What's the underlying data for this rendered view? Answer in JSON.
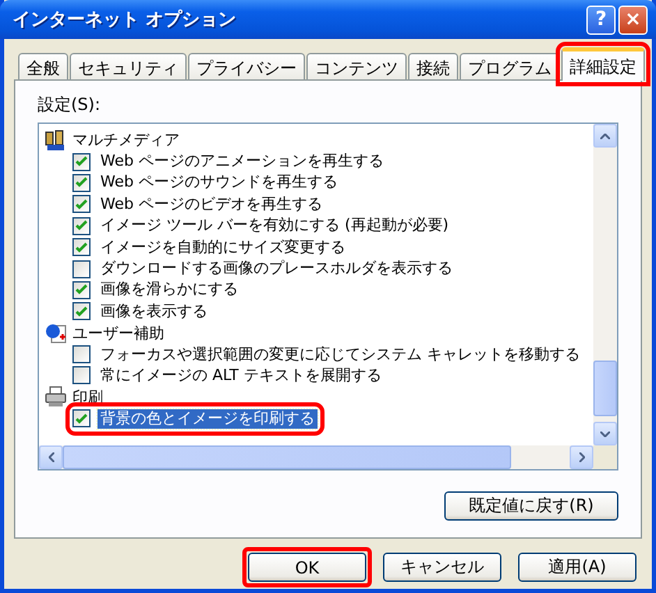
{
  "window": {
    "title": "インターネット オプション",
    "controls": [
      "?",
      "×"
    ]
  },
  "tabs": [
    {
      "label": "全般",
      "selected": false,
      "highlighted": false
    },
    {
      "label": "セキュリティ",
      "selected": false,
      "highlighted": false
    },
    {
      "label": "プライバシー",
      "selected": false,
      "highlighted": false
    },
    {
      "label": "コンテンツ",
      "selected": false,
      "highlighted": false
    },
    {
      "label": "接続",
      "selected": false,
      "highlighted": false
    },
    {
      "label": "プログラム",
      "selected": false,
      "highlighted": false
    },
    {
      "label": "詳細設定",
      "selected": true,
      "highlighted": true
    }
  ],
  "settings_label": "設定(S):",
  "settings": [
    {
      "label": "マルチメディア",
      "children": [
        {
          "label": "Web ページのアニメーションを再生する",
          "checked": true,
          "selected": false,
          "highlighted": false
        },
        {
          "label": "Web ページのサウンドを再生する",
          "checked": true,
          "selected": false,
          "highlighted": false
        },
        {
          "label": "Web ページのビデオを再生する",
          "checked": true,
          "selected": false,
          "highlighted": false
        },
        {
          "label": "イメージ ツール バーを有効にする (再起動が必要)",
          "checked": true,
          "selected": false,
          "highlighted": false
        },
        {
          "label": "イメージを自動的にサイズ変更する",
          "checked": true,
          "selected": false,
          "highlighted": false
        },
        {
          "label": "ダウンロードする画像のプレースホルダを表示する",
          "checked": false,
          "selected": false,
          "highlighted": false
        },
        {
          "label": "画像を滑らかにする",
          "checked": true,
          "selected": false,
          "highlighted": false
        },
        {
          "label": "画像を表示する",
          "checked": true,
          "selected": false,
          "highlighted": false
        }
      ]
    },
    {
      "label": "ユーザー補助",
      "children": [
        {
          "label": "フォーカスや選択範囲の変更に応じてシステム キャレットを移動する",
          "checked": false,
          "selected": false,
          "highlighted": false
        },
        {
          "label": "常にイメージの ALT テキストを展開する",
          "checked": false,
          "selected": false,
          "highlighted": false
        }
      ]
    },
    {
      "label": "印刷",
      "children": [
        {
          "label": "背景の色とイメージを印刷する",
          "checked": true,
          "selected": true,
          "highlighted": true
        }
      ]
    }
  ],
  "reset_button": "既定値に戻す(R)",
  "buttons": [
    {
      "label": "OK",
      "highlighted": true
    },
    {
      "label": "キャンセル",
      "highlighted": false
    },
    {
      "label": "適用(A)",
      "highlighted": false
    }
  ]
}
